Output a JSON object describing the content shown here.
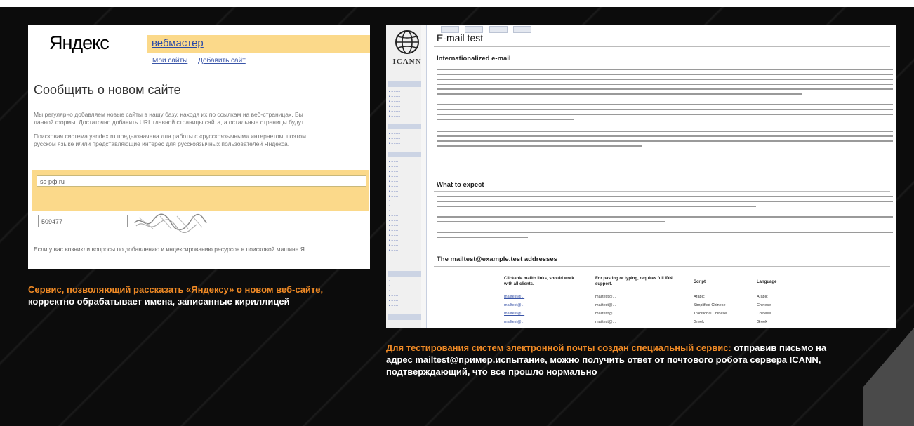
{
  "yandex": {
    "logo": "Яндекс",
    "service_name": "вебмастер",
    "links": [
      "Мои сайты",
      "Добавить сайт"
    ],
    "title": "Сообщить о новом сайте",
    "paragraphs": [
      "Мы регулярно добавляем новые сайты в нашу базу, находя их по ссылкам на веб-страницах. Вы",
      "данной формы. Достаточно добавить URL главной страницы сайта, а остальные страницы будут ",
      "Поисковая система yandex.ru предназначена для работы с «русскоязычным» интернетом, поэтом",
      "русском языке и/или представляющие интерес для русскоязычных пользователей Яндекса."
    ],
    "url_value": "ss-pф.ru",
    "captcha_value": "509477",
    "footer_text": "Если у вас возникли вопросы по добавлению и индексированию ресурсов в поисковой машине Я"
  },
  "icann": {
    "logo_text": "ICANN",
    "page_title": "E-mail test",
    "section1": "Internationalized e-mail",
    "section2": "What to expect",
    "section3": "The mailtest@example.test addresses",
    "table_headers": [
      "Clickable mailto links, should work with all clients.",
      "For pasting or typing, requires full IDN support.",
      "Script",
      "Language"
    ],
    "table_rows": [
      [
        "mailtest@...",
        "mailtest@...",
        "Arabic",
        "Arabic"
      ],
      [
        "mailtest@...",
        "mailtest@...",
        "Simplified Chinese",
        "Chinese"
      ],
      [
        "mailtest@...",
        "mailtest@...",
        "Traditional Chinese",
        "Chinese"
      ],
      [
        "mailtest@...",
        "mailtest@...",
        "Greek",
        "Greek"
      ]
    ]
  },
  "captions": {
    "left_accent": "Сервис, позволяющий рассказать «Яндексу» о новом веб-сайте,",
    "left_rest": " корректно обрабатывает имена, записанные кириллицей",
    "right_accent": "Для тестирования систем электронной почты создан специальный сервис:",
    "right_rest": " отправив письмо на адрес mailtest@пример.испытание, можно получить ответ от почтового робота сервера ICANN, подтверждающий, что все прошло нормально"
  }
}
